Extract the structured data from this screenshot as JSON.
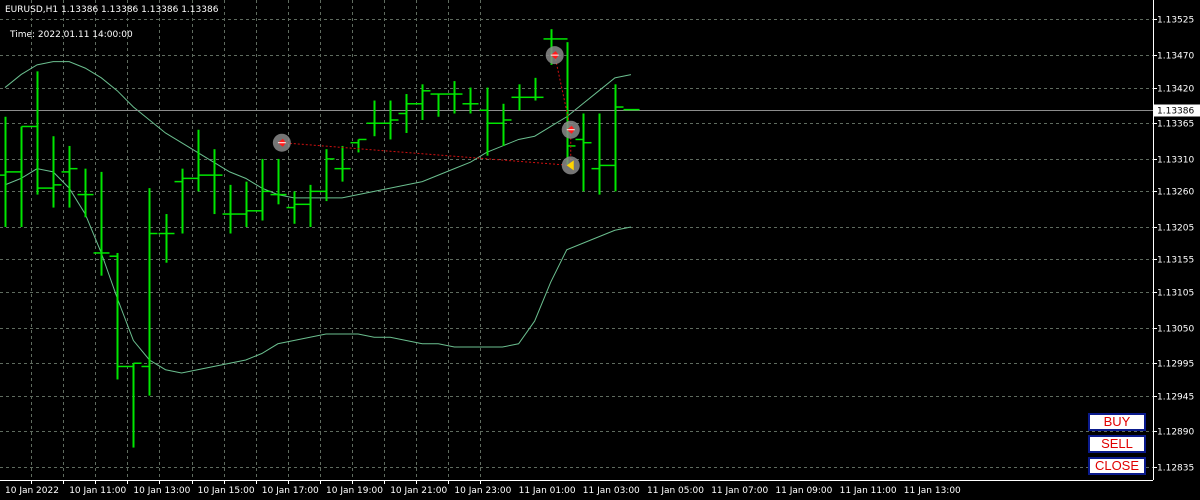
{
  "header": {
    "symbol_line": "EURUSD,H1  1.13386 1.13386 1.13386 1.13386",
    "time_line": "Time: 2022.01.11 14:00:00"
  },
  "buttons": {
    "buy": "BUY",
    "sell": "SELL",
    "close": "CLOSE"
  },
  "colors": {
    "background": "#000000",
    "grid": "#5f6b5f",
    "bars": "#00e600",
    "bands": "#6bbf8f",
    "bid_line": "#8c8c8c",
    "trade_line": "#d01010",
    "button_text": "#e00000",
    "button_border": "#0a1a8c"
  },
  "chart_data": {
    "type": "ohlc",
    "symbol": "EURUSD",
    "timeframe": "H1",
    "ylim": [
      1.12815,
      1.13555
    ],
    "grid": true,
    "current_price": 1.13386,
    "current_price_label": "1.13386",
    "y_ticks": [
      "1.13525",
      "1.13470",
      "1.13420",
      "1.13365",
      "1.13310",
      "1.13260",
      "1.13205",
      "1.13155",
      "1.13105",
      "1.13050",
      "1.12995",
      "1.12945",
      "1.12890",
      "1.12835"
    ],
    "y_tick_values": [
      1.13525,
      1.1347,
      1.1342,
      1.13365,
      1.1331,
      1.1326,
      1.13205,
      1.13155,
      1.13105,
      1.1305,
      1.12995,
      1.12945,
      1.1289,
      1.12835
    ],
    "x_tick_labels": [
      "10 Jan 2022",
      "10 Jan 11:00",
      "10 Jan 13:00",
      "10 Jan 15:00",
      "10 Jan 17:00",
      "10 Jan 19:00",
      "10 Jan 21:00",
      "10 Jan 23:00",
      "11 Jan 01:00",
      "11 Jan 03:00",
      "11 Jan 05:00",
      "11 Jan 07:00",
      "11 Jan 09:00",
      "11 Jan 11:00",
      "11 Jan 13:00"
    ],
    "x_tick_bar_index": [
      0,
      2,
      4,
      6,
      8,
      10,
      12,
      14,
      16,
      18,
      20,
      22,
      24,
      26,
      28
    ],
    "bars": [
      {
        "o": 1.13285,
        "h": 1.13375,
        "l": 1.13205,
        "c": 1.1329
      },
      {
        "o": 1.1329,
        "h": 1.1336,
        "l": 1.13205,
        "c": 1.1336
      },
      {
        "o": 1.1336,
        "h": 1.13445,
        "l": 1.13255,
        "c": 1.13265
      },
      {
        "o": 1.13265,
        "h": 1.13345,
        "l": 1.13235,
        "c": 1.1327
      },
      {
        "o": 1.1329,
        "h": 1.1333,
        "l": 1.13235,
        "c": 1.13295
      },
      {
        "o": 1.13255,
        "h": 1.13295,
        "l": 1.1322,
        "c": 1.13255
      },
      {
        "o": 1.13165,
        "h": 1.1329,
        "l": 1.1313,
        "c": 1.13165
      },
      {
        "o": 1.1316,
        "h": 1.13165,
        "l": 1.1297,
        "c": 1.1299
      },
      {
        "o": 1.1299,
        "h": 1.12995,
        "l": 1.12865,
        "c": 1.12995
      },
      {
        "o": 1.1299,
        "h": 1.13265,
        "l": 1.12945,
        "c": 1.13195
      },
      {
        "o": 1.13195,
        "h": 1.13225,
        "l": 1.1315,
        "c": 1.13195
      },
      {
        "o": 1.13275,
        "h": 1.13295,
        "l": 1.13195,
        "c": 1.1328
      },
      {
        "o": 1.1328,
        "h": 1.13355,
        "l": 1.1326,
        "c": 1.13285
      },
      {
        "o": 1.13285,
        "h": 1.13325,
        "l": 1.13225,
        "c": 1.13285
      },
      {
        "o": 1.13225,
        "h": 1.1327,
        "l": 1.13195,
        "c": 1.13225
      },
      {
        "o": 1.13225,
        "h": 1.13275,
        "l": 1.13205,
        "c": 1.1323
      },
      {
        "o": 1.1323,
        "h": 1.1331,
        "l": 1.13215,
        "c": 1.1326
      },
      {
        "o": 1.13255,
        "h": 1.1331,
        "l": 1.1324,
        "c": 1.13255
      },
      {
        "o": 1.13235,
        "h": 1.1326,
        "l": 1.1321,
        "c": 1.1324
      },
      {
        "o": 1.1324,
        "h": 1.1327,
        "l": 1.13205,
        "c": 1.1326
      },
      {
        "o": 1.1326,
        "h": 1.13325,
        "l": 1.13245,
        "c": 1.1331
      },
      {
        "o": 1.13295,
        "h": 1.1333,
        "l": 1.13275,
        "c": 1.13295
      },
      {
        "o": 1.13335,
        "h": 1.1334,
        "l": 1.1332,
        "c": 1.1334
      },
      {
        "o": 1.13365,
        "h": 1.134,
        "l": 1.13345,
        "c": 1.13365
      },
      {
        "o": 1.13365,
        "h": 1.134,
        "l": 1.1334,
        "c": 1.1337
      },
      {
        "o": 1.1338,
        "h": 1.1341,
        "l": 1.1335,
        "c": 1.13395
      },
      {
        "o": 1.13395,
        "h": 1.13425,
        "l": 1.1337,
        "c": 1.13415
      },
      {
        "o": 1.1341,
        "h": 1.1341,
        "l": 1.13375,
        "c": 1.1341
      },
      {
        "o": 1.1341,
        "h": 1.1343,
        "l": 1.1338,
        "c": 1.1341
      },
      {
        "o": 1.13395,
        "h": 1.1342,
        "l": 1.1338,
        "c": 1.13395
      },
      {
        "o": 1.13385,
        "h": 1.1342,
        "l": 1.13315,
        "c": 1.13365
      },
      {
        "o": 1.13365,
        "h": 1.13395,
        "l": 1.1333,
        "c": 1.1337
      },
      {
        "o": 1.13405,
        "h": 1.13425,
        "l": 1.13385,
        "c": 1.13405
      },
      {
        "o": 1.13405,
        "h": 1.13435,
        "l": 1.134,
        "c": 1.13405
      },
      {
        "o": 1.13495,
        "h": 1.1351,
        "l": 1.13455,
        "c": 1.13495
      },
      {
        "o": 1.13495,
        "h": 1.1349,
        "l": 1.133,
        "c": 1.1333
      },
      {
        "o": 1.1334,
        "h": 1.1338,
        "l": 1.1326,
        "c": 1.13335
      },
      {
        "o": 1.13295,
        "h": 1.1338,
        "l": 1.13255,
        "c": 1.133
      },
      {
        "o": 1.133,
        "h": 1.13425,
        "l": 1.1326,
        "c": 1.1339
      },
      {
        "o": 1.13386,
        "h": 1.13386,
        "l": 1.13386,
        "c": 1.13386
      }
    ],
    "bollinger": {
      "upper": [
        1.1342,
        1.1344,
        1.13455,
        1.1346,
        1.1346,
        1.1345,
        1.13435,
        1.13415,
        1.1339,
        1.1337,
        1.1335,
        1.13335,
        1.1332,
        1.13305,
        1.1329,
        1.1328,
        1.13265,
        1.13255,
        1.1325,
        1.1325,
        1.1325,
        1.1325,
        1.13255,
        1.1326,
        1.13265,
        1.1327,
        1.13275,
        1.13285,
        1.13295,
        1.13305,
        1.1332,
        1.1333,
        1.1334,
        1.13345,
        1.1336,
        1.13375,
        1.13395,
        1.13415,
        1.13435,
        1.1344
      ],
      "middle": [
        1.1327,
        1.1328,
        1.13295,
        1.1329,
        1.13265,
        1.13225,
        1.13165,
        1.13095,
        1.1303,
        1.13,
        1.12985,
        1.1298,
        1.12985,
        1.1299,
        1.12995,
        1.13,
        1.1301,
        1.13025,
        1.1303,
        1.13035,
        1.1304,
        1.1304,
        1.1304,
        1.13035,
        1.13035,
        1.1303,
        1.13025,
        1.13025,
        1.1302,
        1.1302,
        1.1302,
        1.1302,
        1.13025,
        1.1306,
        1.1312,
        1.1317,
        1.1318,
        1.1319,
        1.132,
        1.13205
      ],
      "lower_placeholder": []
    },
    "annotations": [
      {
        "label": "entry",
        "bar": 17,
        "price": 1.13335
      },
      {
        "label": "exit",
        "bar": 34,
        "price": 1.1347
      },
      {
        "label": "exit",
        "bar": 35,
        "price": 1.13355
      },
      {
        "label": "close",
        "bar": 35,
        "price": 1.133
      }
    ]
  }
}
